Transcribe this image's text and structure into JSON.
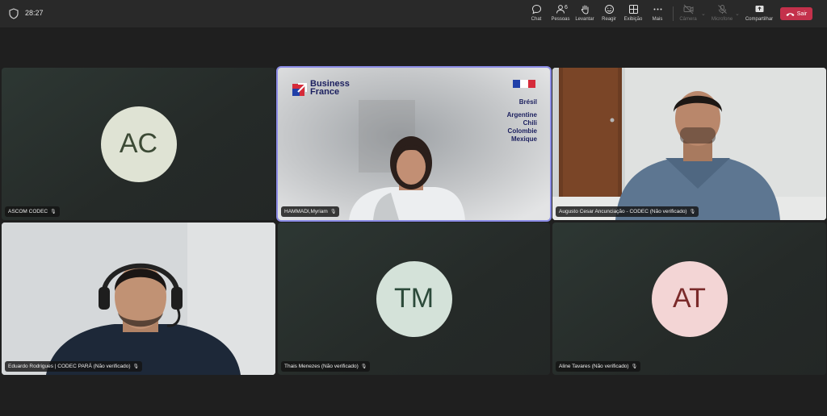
{
  "topbar": {
    "timer": "28:27",
    "buttons": [
      {
        "label": "Chat",
        "icon": "chat-icon"
      },
      {
        "label": "Pessoas",
        "icon": "people-icon",
        "count": "6"
      },
      {
        "label": "Levantar",
        "icon": "raise-hand-icon"
      },
      {
        "label": "Reagir",
        "icon": "react-icon"
      },
      {
        "label": "Exibição",
        "icon": "view-icon"
      },
      {
        "label": "Mais",
        "icon": "more-icon"
      },
      {
        "label": "Câmera",
        "icon": "camera-off-icon"
      },
      {
        "label": "Microfone",
        "icon": "mic-off-icon"
      },
      {
        "label": "Compartilhar",
        "icon": "share-icon"
      }
    ],
    "leave_label": "Sair",
    "leave_color": "#c4314b"
  },
  "participants": [
    {
      "name": "ASCOM CODEC",
      "initials": "AC",
      "avatar_bg": "#dfe3d4",
      "avatar_color": "#3c4a35"
    },
    {
      "name": "HAMMADI,Myriam",
      "video": true,
      "slide": {
        "brand": [
          "Business",
          "France"
        ],
        "country_main": "Brésil",
        "countries": [
          "Argentine",
          "Chili",
          "Colombie",
          "Mexique"
        ]
      }
    },
    {
      "name": "Augusto Cesar Ancunciação - CODEC (Não verificado)",
      "video": true
    },
    {
      "name": "Eduardo Rodrigues | CODEC PARÁ (Não verificado)",
      "video": true
    },
    {
      "name": "Thais Menezes (Não verificado)",
      "initials": "TM",
      "avatar_bg": "#d4e2d9",
      "avatar_color": "#2c4a3a"
    },
    {
      "name": "Aline Tavares (Não verificado)",
      "initials": "AT",
      "avatar_bg": "#f3d5d5",
      "avatar_color": "#7a2a2a"
    }
  ],
  "speaking_highlight": "#8b8ce6"
}
